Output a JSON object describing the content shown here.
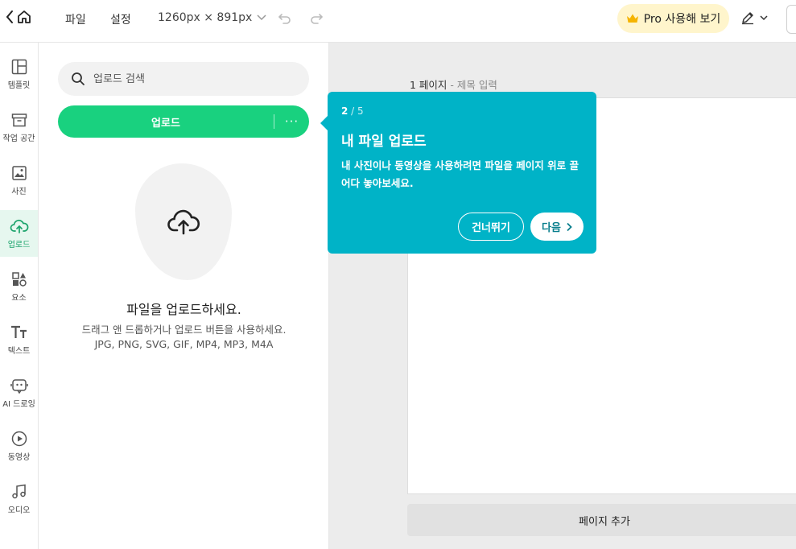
{
  "topbar": {
    "menu_file": "파일",
    "menu_settings": "설정",
    "canvas_size": "1260px × 891px",
    "pro_label": "Pro 사용해 보기"
  },
  "rail": {
    "items": [
      {
        "label": "템플릿",
        "icon": "layout-icon"
      },
      {
        "label": "작업 공간",
        "icon": "archive-icon"
      },
      {
        "label": "사진",
        "icon": "image-icon"
      },
      {
        "label": "업로드",
        "icon": "cloud-upload-icon",
        "active": true
      },
      {
        "label": "요소",
        "icon": "shapes-icon"
      },
      {
        "label": "텍스트",
        "icon": "text-icon"
      },
      {
        "label": "AI 드로잉",
        "icon": "ai-drawing-icon"
      },
      {
        "label": "동영상",
        "icon": "video-icon"
      },
      {
        "label": "오디오",
        "icon": "music-icon"
      }
    ]
  },
  "panel": {
    "search_placeholder": "업로드 검색",
    "upload_label": "업로드",
    "more_label": "···",
    "drop_title": "파일을 업로드하세요.",
    "drop_line1": "드래그 앤 드롭하거나 업로드 버튼을 사용하세요.",
    "drop_line2": "JPG, PNG, SVG, GIF, MP4, MP3, M4A"
  },
  "canvas": {
    "page_number": "1 페이지",
    "separator": " - ",
    "page_title_placeholder": "제목 입력",
    "add_page": "페이지 추가"
  },
  "tooltip": {
    "step_current": "2",
    "step_total": " / 5",
    "title": "내 파일 업로드",
    "body": "내 사진이나 동영상을 사용하려면 파일을 페이지 위로 끌어다 놓아보세요.",
    "skip": "건너뛰기",
    "next": "다음"
  },
  "colors": {
    "accent_green": "#19d17f",
    "tooltip_bg": "#00b3c7",
    "pro_bg": "#fff5cc"
  }
}
